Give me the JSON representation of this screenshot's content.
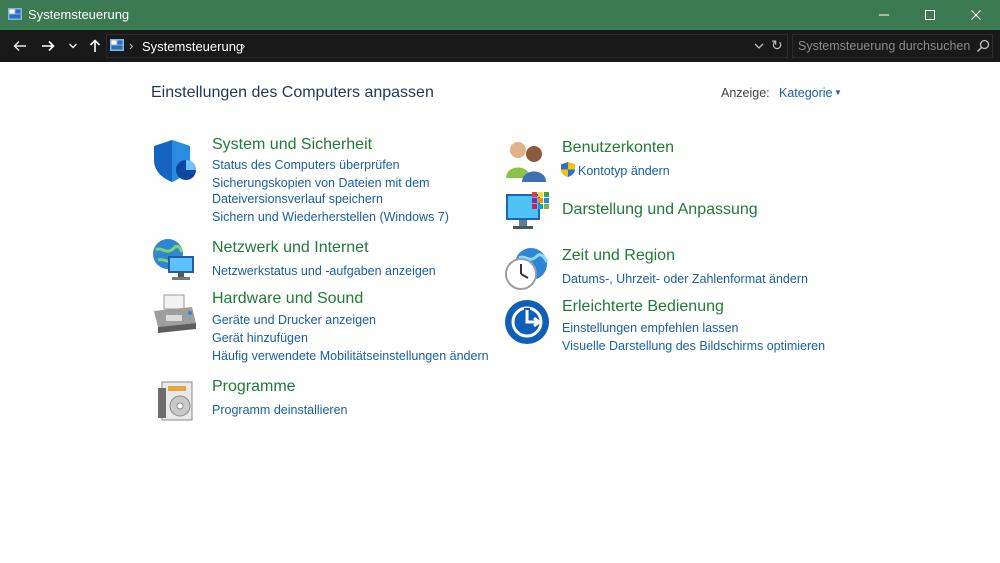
{
  "window": {
    "title": "Systemsteuerung"
  },
  "address": {
    "path": "Systemsteuerung",
    "search_placeholder": "Systemsteuerung durchsuchen"
  },
  "header": {
    "title": "Einstellungen des Computers anpassen",
    "view_label": "Anzeige:",
    "view_value": "Kategorie"
  },
  "categories": [
    {
      "icon": "shield-icon",
      "title": "System und Sicherheit",
      "links": [
        "Status des Computers überprüfen",
        "Sicherungskopien von Dateien mit dem",
        "Dateiversionsverlauf speichern",
        "Sichern und Wiederherstellen (Windows 7)"
      ]
    },
    {
      "icon": "network-globe-icon",
      "title": "Netzwerk und Internet",
      "links": [
        "Netzwerkstatus und -aufgaben anzeigen"
      ]
    },
    {
      "icon": "printer-icon",
      "title": "Hardware und Sound",
      "links": [
        "Geräte und Drucker anzeigen",
        "Gerät hinzufügen",
        "Häufig verwendete Mobilitätseinstellungen ändern"
      ]
    },
    {
      "icon": "programs-box-icon",
      "title": "Programme",
      "links": [
        "Programm deinstallieren"
      ]
    },
    {
      "icon": "user-accounts-icon",
      "title": "Benutzerkonten",
      "links": [
        "Kontotyp ändern"
      ]
    },
    {
      "icon": "monitor-palette-icon",
      "title": "Darstellung und Anpassung",
      "links": []
    },
    {
      "icon": "clock-globe-icon",
      "title": "Zeit und Region",
      "links": [
        "Datums-, Uhrzeit- oder Zahlenformat ändern"
      ]
    },
    {
      "icon": "ease-of-access-icon",
      "title": "Erleichterte Bedienung",
      "links": [
        "Einstellungen empfehlen lassen",
        "Visuelle Darstellung des Bildschirms optimieren"
      ]
    }
  ],
  "colors": {
    "titlebar": "#3c7a52",
    "category_title": "#217a35",
    "link": "#1a5fa8",
    "page_title": "#1e395b"
  }
}
